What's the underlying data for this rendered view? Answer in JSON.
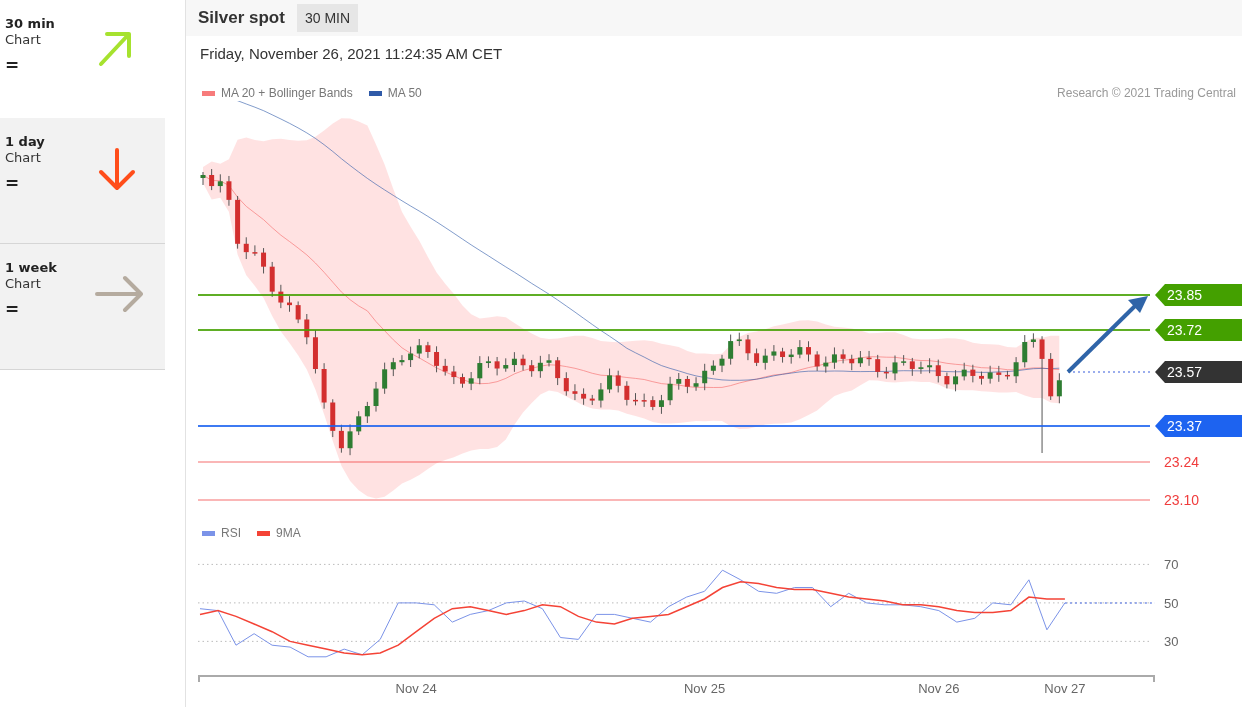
{
  "sidebar": {
    "items": [
      {
        "timeframe": "30 min",
        "label": "Chart",
        "signal": "=",
        "kind": "up-right",
        "color": "#a6e22e",
        "selected": true
      },
      {
        "timeframe": "1 day",
        "label": "Chart",
        "signal": "=",
        "kind": "down",
        "color": "#ff4d1a",
        "selected": false
      },
      {
        "timeframe": "1 week",
        "label": "Chart",
        "signal": "=",
        "kind": "right",
        "color": "#b5ab9f",
        "selected": false
      }
    ]
  },
  "header": {
    "title": "Silver spot",
    "interval": "30 MIN"
  },
  "timestamp": "Friday, November 26, 2021 11:24:35 AM CET",
  "price_chart": {
    "legend": [
      {
        "label": "MA 20 + Bollinger Bands",
        "color": "#f77b7b"
      },
      {
        "label": "MA 50",
        "color": "#2f5aa8"
      }
    ],
    "credit": "Research © 2021 Trading Central",
    "levels": [
      {
        "label": "23.85",
        "kind": "line-tag",
        "color": "#44a000"
      },
      {
        "label": "23.72",
        "kind": "line-tag",
        "color": "#44a000"
      },
      {
        "label": "23.57",
        "kind": "price-tag",
        "color": "#333333"
      },
      {
        "label": "23.37",
        "kind": "line-tag",
        "color": "#1d63f0"
      },
      {
        "label": "23.24",
        "kind": "line-text",
        "color": "#f03c3c"
      },
      {
        "label": "23.10",
        "kind": "line-text",
        "color": "#f03c3c"
      }
    ]
  },
  "rsi_chart": {
    "chart_data": {
      "type": "line",
      "grid": true,
      "categories": [
        null,
        null,
        null,
        null,
        null,
        null,
        null,
        null,
        null,
        null,
        null,
        null,
        "Nov 24",
        null,
        null,
        null,
        null,
        null,
        null,
        null,
        null,
        null,
        null,
        null,
        null,
        null,
        null,
        null,
        "Nov 25",
        null,
        null,
        null,
        null,
        null,
        null,
        null,
        null,
        null,
        null,
        null,
        null,
        "Nov 26",
        null,
        null,
        null,
        null,
        null,
        null,
        "Nov 27",
        null,
        null,
        null,
        null,
        null
      ],
      "ylim": [
        12,
        70
      ],
      "yticks": [
        30,
        50,
        70
      ],
      "series": [
        {
          "name": "RSI",
          "color": "#7b93e8",
          "values": [
            47,
            46,
            28,
            34,
            28,
            27,
            22,
            22,
            26,
            23,
            31,
            50,
            50,
            49,
            40,
            44,
            46,
            50,
            51,
            47,
            32,
            31,
            44,
            44,
            42,
            40,
            48,
            53,
            56,
            67,
            62,
            56,
            55,
            58,
            58,
            48,
            55,
            50,
            49,
            49,
            48,
            46,
            40,
            42,
            50,
            49,
            62,
            36,
            50,
            50,
            50,
            50,
            50,
            50
          ]
        },
        {
          "name": "9MA",
          "color": "#f44336",
          "values": [
            44,
            46,
            43,
            39,
            35,
            30,
            28,
            26,
            24,
            23,
            24,
            28,
            35,
            42,
            47,
            48,
            46,
            44,
            46,
            49,
            48,
            43,
            40,
            39,
            42,
            43,
            44,
            48,
            52,
            58,
            61,
            60,
            58,
            57,
            57,
            55,
            53,
            52,
            51,
            49,
            49,
            48,
            46,
            45,
            45,
            46,
            53,
            52,
            52,
            null,
            null,
            null,
            null,
            null
          ]
        }
      ]
    }
  }
}
